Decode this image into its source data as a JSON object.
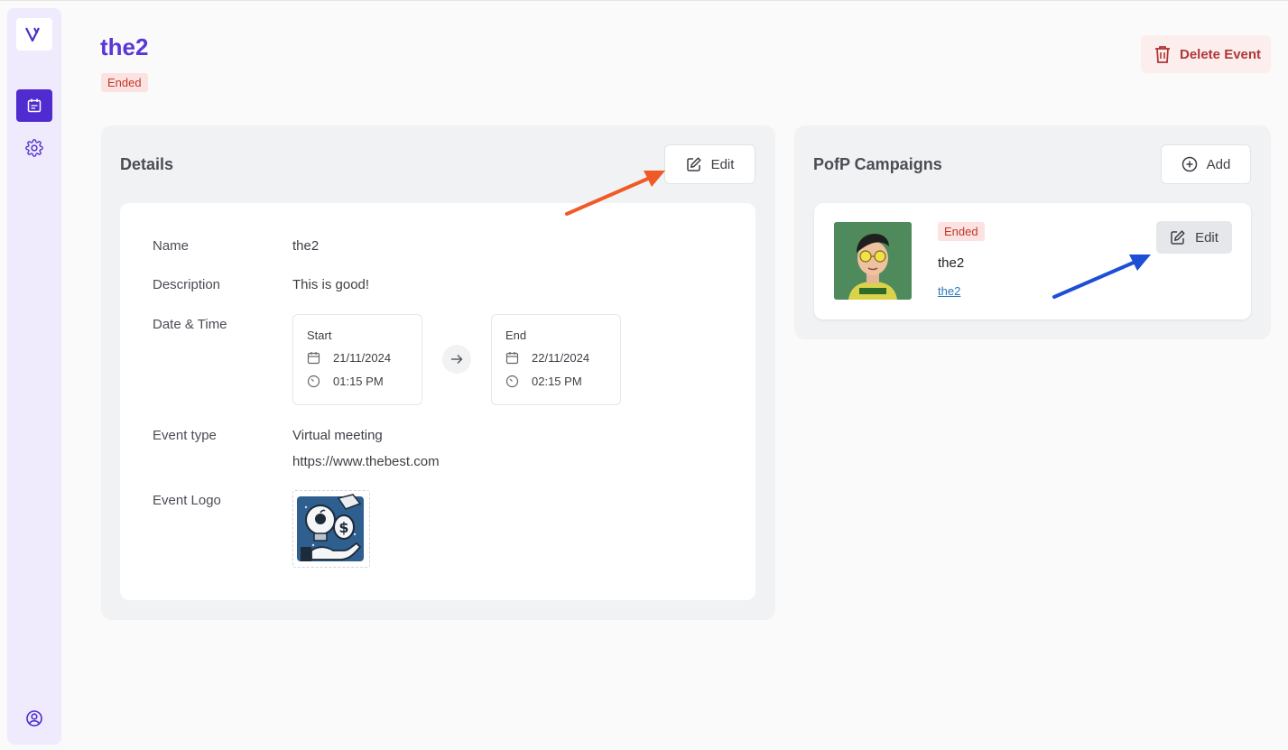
{
  "header": {
    "title": "the2",
    "status": "Ended",
    "delete_label": "Delete Event"
  },
  "details": {
    "title": "Details",
    "edit_label": "Edit",
    "fields": {
      "name_label": "Name",
      "name_value": "the2",
      "description_label": "Description",
      "description_value": "This is good!",
      "datetime_label": "Date & Time",
      "start_label": "Start",
      "start_date": "21/11/2024",
      "start_time": "01:15 PM",
      "end_label": "End",
      "end_date": "22/11/2024",
      "end_time": "02:15 PM",
      "event_type_label": "Event type",
      "event_type_value": "Virtual meeting",
      "event_url": "https://www.thebest.com",
      "event_logo_label": "Event Logo"
    }
  },
  "campaigns": {
    "title": "PofP Campaigns",
    "add_label": "Add",
    "items": [
      {
        "status": "Ended",
        "name": "the2",
        "link": "the2",
        "edit_label": "Edit"
      }
    ]
  },
  "icons": {
    "logo": "v-logo-icon",
    "events": "calendar-icon",
    "settings": "gear-icon",
    "profile": "user-circle-icon"
  },
  "colors": {
    "accent": "#5b37d6",
    "sidebar_active": "#4f2bd0",
    "danger": "#b03636",
    "annotation_orange": "#f05a28",
    "annotation_blue": "#1c4fd6"
  }
}
